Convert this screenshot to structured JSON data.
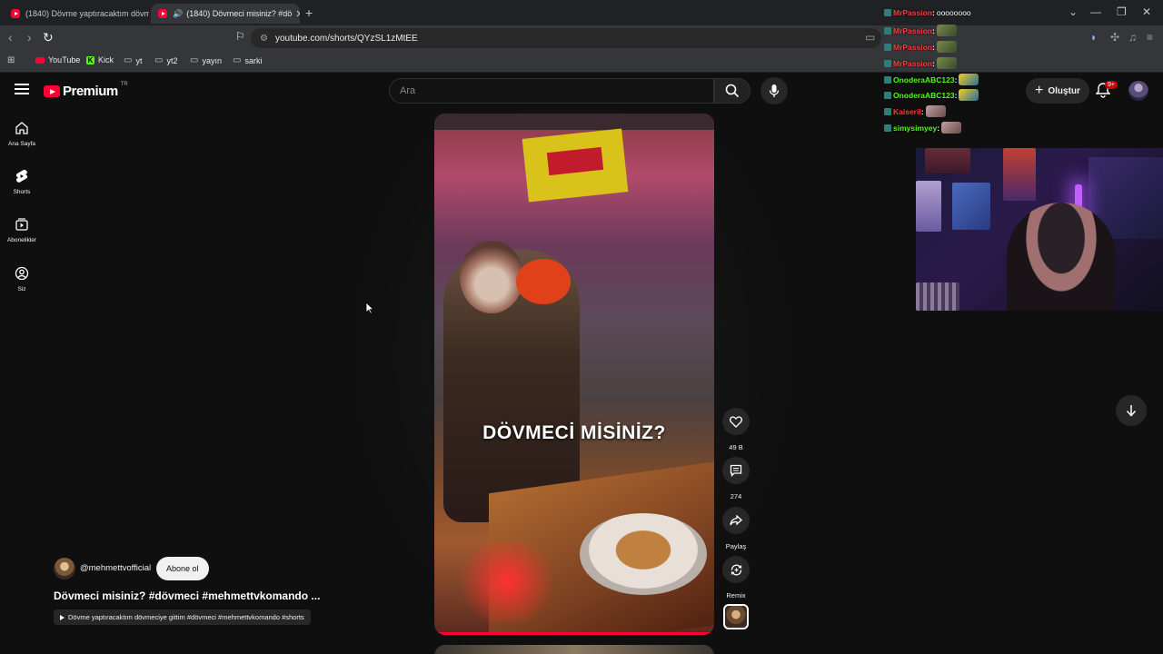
{
  "browser": {
    "tabs": [
      {
        "title": "(1840) Dövme yaptıracaktım dövme"
      },
      {
        "title": "(1840) Dövmeci misiniz? #dö"
      }
    ],
    "url": "youtube.com/shorts/QYzSL1zMtEE",
    "bookmarks": [
      "YouTube",
      "Kick",
      "yt",
      "yt2",
      "yayın",
      "sarki"
    ]
  },
  "youtube": {
    "logo_text": "Premium",
    "country_code": "TR",
    "search_placeholder": "Ara",
    "create_label": "Oluştur",
    "notif_count": "9+",
    "guide": [
      {
        "label": "Ana Sayfa",
        "icon": "home-icon"
      },
      {
        "label": "Shorts",
        "icon": "shorts-icon"
      },
      {
        "label": "Abonelikler",
        "icon": "subscriptions-icon"
      },
      {
        "label": "Siz",
        "icon": "you-icon"
      }
    ]
  },
  "short": {
    "caption": "DÖVMECİ MİSİNİZ?",
    "channel": "@mehmettvofficial",
    "subscribe_label": "Abone ol",
    "title": "Dövmeci misiniz? #dövmeci #mehmettvkomando ...",
    "related_video": "Dövme yaptıracaktım dövmeciye gittim #dövmeci #mehmettvkomando #shorts",
    "progress": 1.0,
    "actions": {
      "like_count": "49 B",
      "comment_count": "274",
      "share_label": "Paylaş",
      "remix_label": "Remix"
    }
  },
  "stream_chat": [
    {
      "user": "MrPassion",
      "message": "oooooooo",
      "color": "#ff3b3b"
    },
    {
      "user": "MrPassion",
      "message": "",
      "color": "#ff3b3b"
    },
    {
      "user": "MrPassion",
      "message": "",
      "color": "#ff3b3b"
    },
    {
      "user": "MrPassion",
      "message": "",
      "color": "#ff3b3b"
    },
    {
      "user": "OnoderaABC123",
      "message": "",
      "color": "#53fc18"
    },
    {
      "user": "OnoderaABC123",
      "message": "",
      "color": "#53fc18"
    },
    {
      "user": "Kaiseril",
      "message": "",
      "color": "#ff3b3b"
    },
    {
      "user": "simysimyey",
      "message": "",
      "color": "#53fc18"
    }
  ]
}
